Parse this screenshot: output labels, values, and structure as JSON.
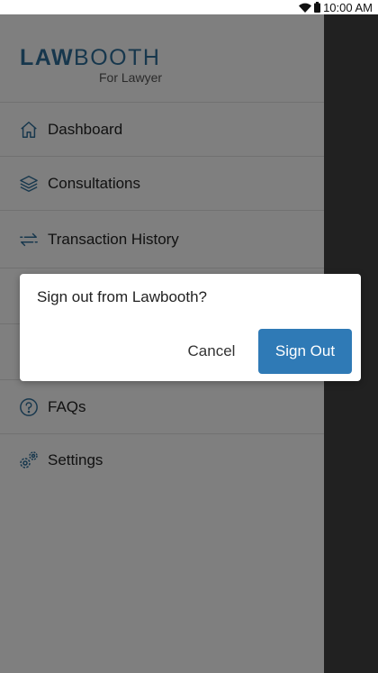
{
  "status_bar": {
    "time": "10:00 AM",
    "icons": [
      "wifi-icon",
      "battery-icon"
    ]
  },
  "app": {
    "logo_law": "LAW",
    "logo_booth": "BOOTH",
    "logo_sub": "For Lawyer",
    "brand_color": "#2f6f9a"
  },
  "menu": {
    "items": [
      {
        "label": "Dashboard",
        "icon": "home-icon"
      },
      {
        "label": "Consultations",
        "icon": "layers-icon"
      },
      {
        "label": "Transaction History",
        "icon": "transfer-arrows-icon"
      },
      {
        "label": "",
        "icon": "hidden-item-icon"
      },
      {
        "label": "",
        "icon": "hidden-item-icon"
      },
      {
        "label": "FAQs",
        "icon": "help-circle-icon"
      },
      {
        "label": "Settings",
        "icon": "gears-icon"
      }
    ]
  },
  "dialog": {
    "message": "Sign out from Lawbooth?",
    "cancel_label": "Cancel",
    "confirm_label": "Sign Out",
    "confirm_color": "#2f7ab6"
  }
}
